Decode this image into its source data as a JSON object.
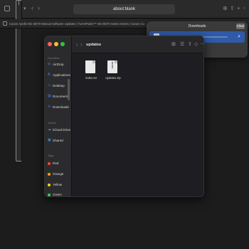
{
  "browser": {
    "address": "about:blank",
    "tab_title": "Canon Apollo NG 66/70 Manual Software Updates | TurretPatch™ NG 66/70 Series Series | Canon Customer Support"
  },
  "downloads": {
    "title": "Downloads",
    "clear_label": "Clear"
  },
  "finder": {
    "folder_title": "updates",
    "favorites_header": "Favorites",
    "favorites": [
      {
        "label": "AirDrop",
        "icon": "airdrop-icon"
      },
      {
        "label": "Applications",
        "icon": "applications-icon"
      },
      {
        "label": "Desktop",
        "icon": "desktop-icon"
      },
      {
        "label": "Documents",
        "icon": "documents-icon"
      },
      {
        "label": "Downloads",
        "icon": "downloads-icon"
      }
    ],
    "cloud_header": "iCloud",
    "cloud": [
      {
        "label": "iCloud Drive",
        "icon": "cloud-icon"
      },
      {
        "label": "Shared",
        "icon": "shared-folder-icon"
      }
    ],
    "tags_header": "Tags",
    "tags": [
      {
        "label": "Red",
        "color": "#ff453a"
      },
      {
        "label": "Orange",
        "color": "#ff9f0a"
      },
      {
        "label": "Yellow",
        "color": "#ffd60a"
      },
      {
        "label": "Green",
        "color": "#30d158"
      }
    ],
    "files": [
      {
        "name": "index.txt",
        "icon": "text-document-icon"
      },
      {
        "name": "updates.zip",
        "icon": "zip-archive-icon"
      }
    ]
  }
}
